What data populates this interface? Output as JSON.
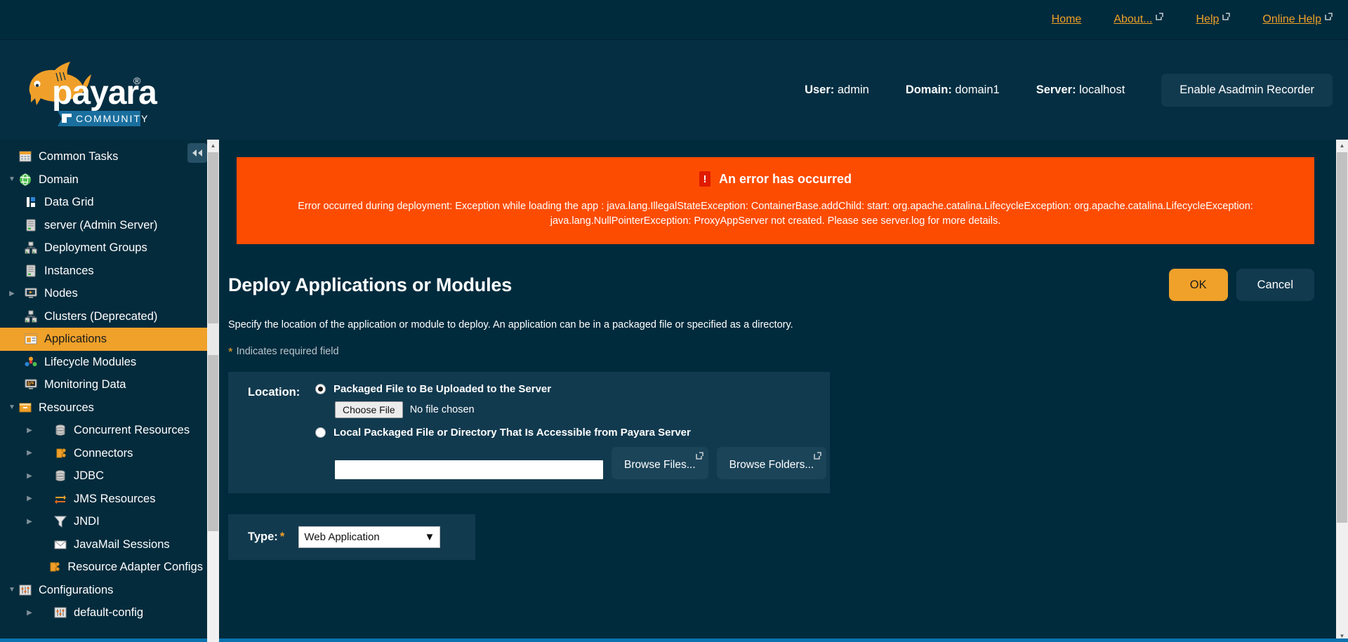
{
  "topnav": {
    "links": [
      {
        "label": "Home",
        "external": false
      },
      {
        "label": "About...",
        "external": true
      },
      {
        "label": "Help",
        "external": true
      },
      {
        "label": "Online Help",
        "external": true
      }
    ]
  },
  "brand": {
    "name": "payara",
    "registered": "®",
    "edition": "COMMUNITY"
  },
  "header": {
    "user_label": "User:",
    "user_value": "admin",
    "domain_label": "Domain:",
    "domain_value": "domain1",
    "server_label": "Server:",
    "server_value": "localhost",
    "recorder_button": "Enable Asadmin Recorder"
  },
  "sidebar": {
    "collapse_icon": "◀◀",
    "items": [
      {
        "label": "Common Tasks",
        "level": 0,
        "twisty": "",
        "icon": "common-tasks-icon",
        "selected": false
      },
      {
        "label": "Domain",
        "level": 0,
        "twisty": "down",
        "icon": "domain-globe-icon",
        "selected": false
      },
      {
        "label": "Data Grid",
        "level": 1,
        "twisty": "",
        "icon": "data-grid-icon",
        "selected": false
      },
      {
        "label": "server (Admin Server)",
        "level": 1,
        "twisty": "",
        "icon": "server-icon",
        "selected": false
      },
      {
        "label": "Deployment Groups",
        "level": 1,
        "twisty": "",
        "icon": "deployment-groups-icon",
        "selected": false
      },
      {
        "label": "Instances",
        "level": 1,
        "twisty": "",
        "icon": "server-icon",
        "selected": false
      },
      {
        "label": "Nodes",
        "level": 1,
        "twisty": "right",
        "icon": "nodes-icon",
        "selected": false
      },
      {
        "label": "Clusters (Deprecated)",
        "level": 1,
        "twisty": "",
        "icon": "clusters-icon",
        "selected": false
      },
      {
        "label": "Applications",
        "level": 1,
        "twisty": "",
        "icon": "applications-icon",
        "selected": true
      },
      {
        "label": "Lifecycle Modules",
        "level": 1,
        "twisty": "",
        "icon": "lifecycle-modules-icon",
        "selected": false
      },
      {
        "label": "Monitoring Data",
        "level": 1,
        "twisty": "",
        "icon": "monitoring-data-icon",
        "selected": false
      },
      {
        "label": "Resources",
        "level": 0,
        "twisty": "down",
        "icon": "resources-box-icon",
        "selected": false
      },
      {
        "label": "Concurrent Resources",
        "level": 2,
        "twisty": "right",
        "icon": "database-icon",
        "selected": false
      },
      {
        "label": "Connectors",
        "level": 2,
        "twisty": "right",
        "icon": "connectors-puzzle-icon",
        "selected": false
      },
      {
        "label": "JDBC",
        "level": 2,
        "twisty": "right",
        "icon": "database-icon",
        "selected": false
      },
      {
        "label": "JMS Resources",
        "level": 2,
        "twisty": "right",
        "icon": "jms-arrows-icon",
        "selected": false
      },
      {
        "label": "JNDI",
        "level": 2,
        "twisty": "right",
        "icon": "jndi-funnel-icon",
        "selected": false
      },
      {
        "label": "JavaMail Sessions",
        "level": 2,
        "twisty": "",
        "icon": "mail-icon",
        "selected": false
      },
      {
        "label": "Resource Adapter Configs",
        "level": 2,
        "twisty": "",
        "icon": "connectors-puzzle-icon",
        "selected": false
      },
      {
        "label": "Configurations",
        "level": 0,
        "twisty": "down",
        "icon": "configurations-icon",
        "selected": false
      },
      {
        "label": "default-config",
        "level": 2,
        "twisty": "right",
        "icon": "configurations-icon",
        "selected": false
      }
    ]
  },
  "error": {
    "title": "An error has occurred",
    "bang": "!",
    "message": "Error occurred during deployment: Exception while loading the app : java.lang.IllegalStateException: ContainerBase.addChild: start: org.apache.catalina.LifecycleException: org.apache.catalina.LifecycleException: java.lang.NullPointerException: ProxyAppServer not created. Please see server.log for more details."
  },
  "page": {
    "title": "Deploy Applications or Modules",
    "ok_button": "OK",
    "cancel_button": "Cancel",
    "description": "Specify the location of the application or module to deploy. An application can be in a packaged file or specified as a directory.",
    "required_star": "*",
    "required_note": "Indicates required field"
  },
  "location": {
    "label": "Location:",
    "option_upload": "Packaged File to Be Uploaded to the Server",
    "option_local": "Local Packaged File or Directory That Is Accessible from Payara Server",
    "selected_option": "upload",
    "choose_file_button": "Choose File",
    "no_file_text": "No file chosen",
    "path_value": "",
    "browse_files_button": "Browse Files...",
    "browse_folders_button": "Browse Folders..."
  },
  "type": {
    "label": "Type:",
    "required_star": "*",
    "selected": "Web Application",
    "options": [
      "Web Application"
    ],
    "caret": "▼"
  },
  "colors": {
    "page_bg": "#002b3d",
    "header_bg": "#052e42",
    "panel_bg": "#123a4f",
    "accent_orange": "#efa12a",
    "link_orange": "#f0a126",
    "error_bg": "#fc4c02",
    "error_bang_bg": "#e01b00"
  }
}
